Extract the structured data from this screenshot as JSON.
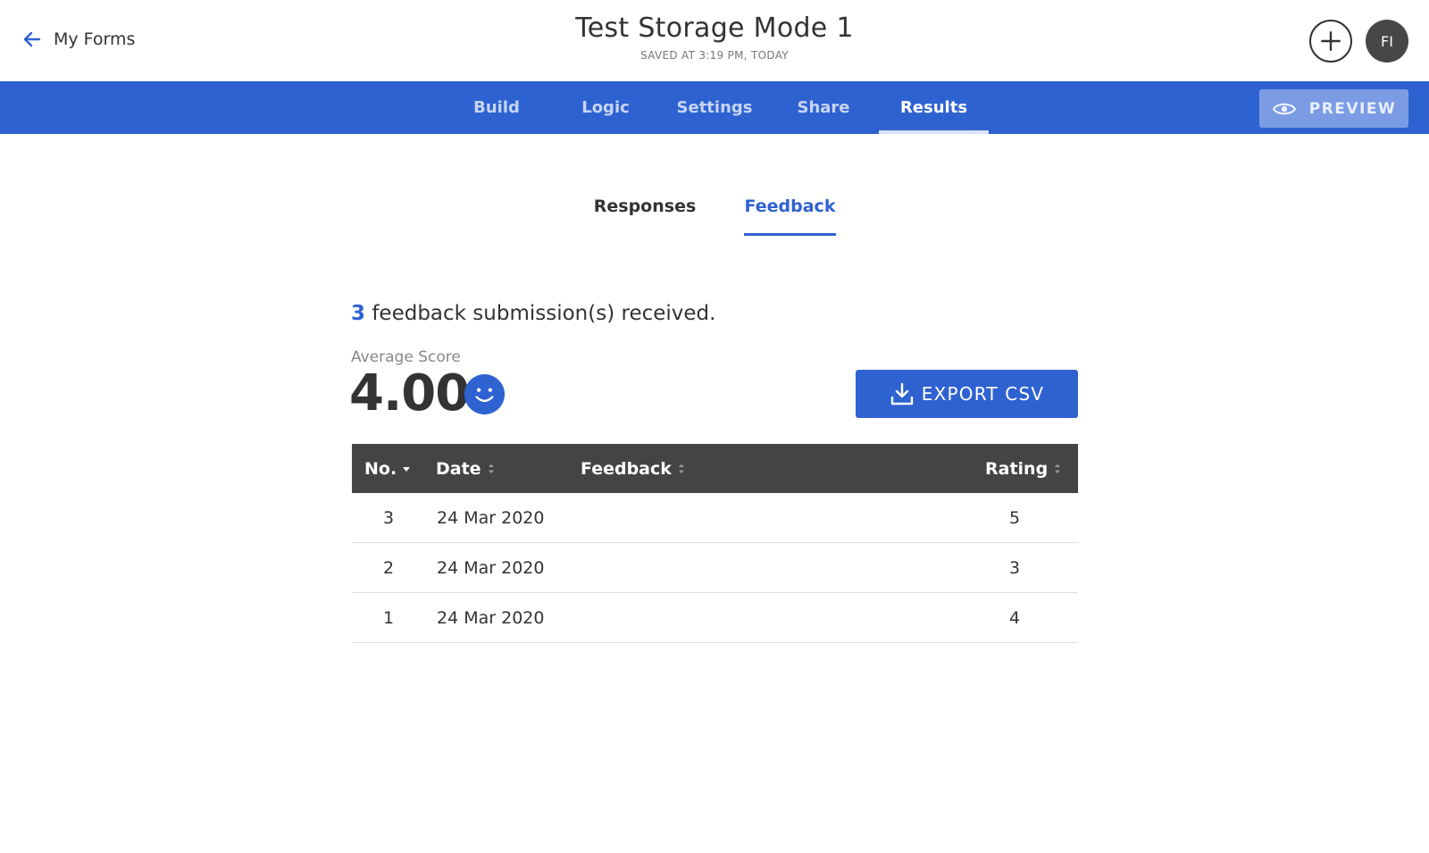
{
  "header": {
    "back_label": "My Forms",
    "title": "Test Storage Mode 1",
    "saved_status": "SAVED AT 3:19 PM, TODAY",
    "avatar_initials": "FI"
  },
  "nav": {
    "tabs": [
      {
        "label": "Build"
      },
      {
        "label": "Logic"
      },
      {
        "label": "Settings"
      },
      {
        "label": "Share"
      },
      {
        "label": "Results"
      }
    ],
    "active_tab": "Results",
    "preview_label": "PREVIEW"
  },
  "subtabs": {
    "items": [
      {
        "label": "Responses"
      },
      {
        "label": "Feedback"
      }
    ],
    "active": "Feedback"
  },
  "summary": {
    "count": "3",
    "text": "feedback submission(s) received.",
    "average_label": "Average Score",
    "average_value": "4.00",
    "export_label": "EXPORT CSV"
  },
  "table": {
    "columns": [
      {
        "label": "No."
      },
      {
        "label": "Date"
      },
      {
        "label": "Feedback"
      },
      {
        "label": "Rating"
      }
    ],
    "rows": [
      {
        "no": "3",
        "date": "24 Mar 2020",
        "feedback": "",
        "rating": "5"
      },
      {
        "no": "2",
        "date": "24 Mar 2020",
        "feedback": "",
        "rating": "3"
      },
      {
        "no": "1",
        "date": "24 Mar 2020",
        "feedback": "",
        "rating": "4"
      }
    ]
  },
  "colors": {
    "primary": "#2f62d1",
    "header_dark": "#444444",
    "preview_bg": "#7b9be4"
  },
  "icons": {
    "back": "arrow-left-icon",
    "add": "plus-icon",
    "preview": "eye-icon",
    "score": "smiley-icon",
    "export": "download-icon",
    "sort": "sort-icon"
  }
}
